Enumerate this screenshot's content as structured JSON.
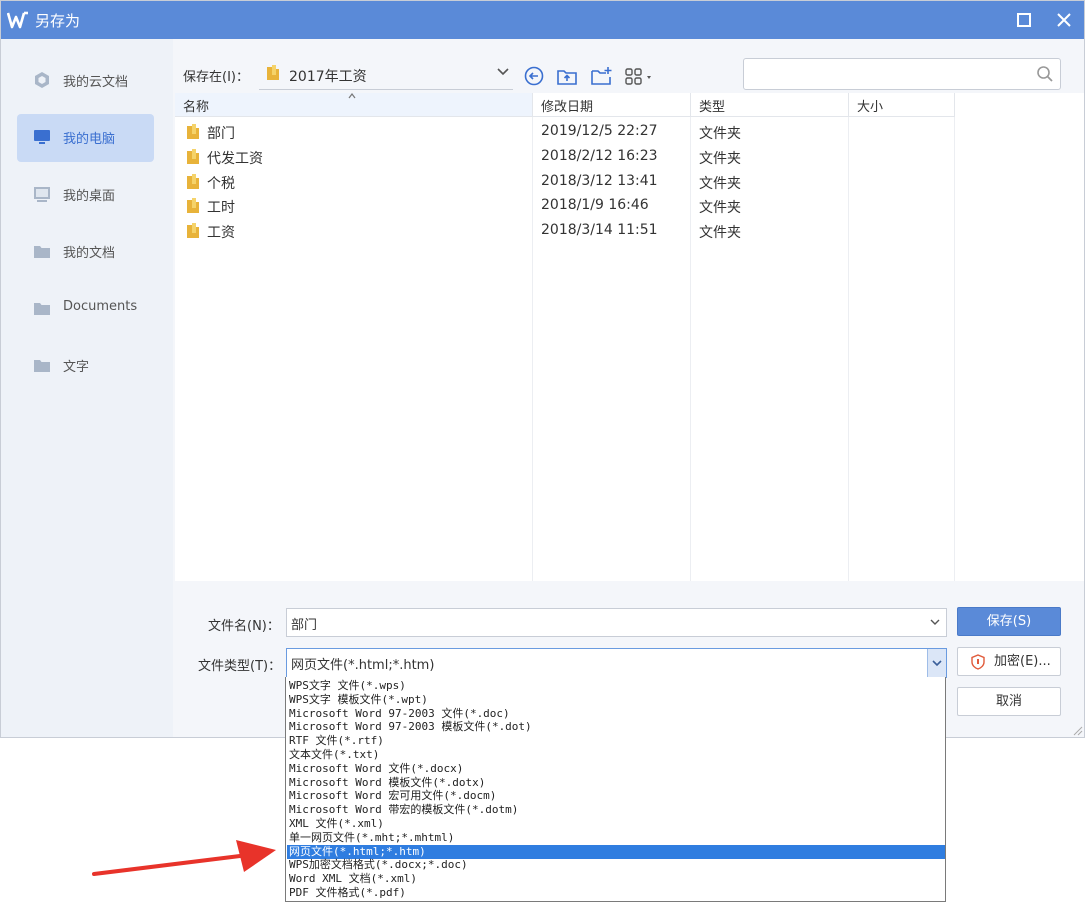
{
  "window": {
    "title": "另存为"
  },
  "sidebar": {
    "items": [
      {
        "label": "我的云文档",
        "icon": "cloud-docs-icon"
      },
      {
        "label": "我的电脑",
        "icon": "computer-icon",
        "active": true
      },
      {
        "label": "我的桌面",
        "icon": "desktop-icon"
      },
      {
        "label": "我的文档",
        "icon": "folder-icon"
      },
      {
        "label": "Documents",
        "icon": "folder-icon"
      },
      {
        "label": "文字",
        "icon": "folder-icon"
      }
    ]
  },
  "location": {
    "label": "保存在(I)：",
    "path": "2017年工资"
  },
  "columns": {
    "name": "名称",
    "modified": "修改日期",
    "type": "类型",
    "size": "大小"
  },
  "files": [
    {
      "name": "部门",
      "modified": "2019/12/5 22:27",
      "type": "文件夹"
    },
    {
      "name": "代发工资",
      "modified": "2018/2/12 16:23",
      "type": "文件夹"
    },
    {
      "name": "个税",
      "modified": "2018/3/12 13:41",
      "type": "文件夹"
    },
    {
      "name": "工时",
      "modified": "2018/1/9 16:46",
      "type": "文件夹"
    },
    {
      "name": "工资",
      "modified": "2018/3/14 11:51",
      "type": "文件夹"
    }
  ],
  "form": {
    "filename_label": "文件名(N)：",
    "filename_value": "部门",
    "filetype_label": "文件类型(T)：",
    "filetype_value": "网页文件(*.html;*.htm)"
  },
  "buttons": {
    "save": "保存(S)",
    "encrypt": "加密(E)...",
    "cancel": "取消"
  },
  "filetype_options": [
    "WPS文字 文件(*.wps)",
    "WPS文字 模板文件(*.wpt)",
    "Microsoft Word 97-2003 文件(*.doc)",
    "Microsoft Word 97-2003 模板文件(*.dot)",
    "RTF 文件(*.rtf)",
    "文本文件(*.txt)",
    "Microsoft Word 文件(*.docx)",
    "Microsoft Word 模板文件(*.dotx)",
    "Microsoft Word 宏可用文件(*.docm)",
    "Microsoft Word 带宏的模板文件(*.dotm)",
    "XML 文件(*.xml)",
    "单一网页文件(*.mht;*.mhtml)",
    "网页文件(*.html;*.htm)",
    "WPS加密文档格式(*.docx;*.doc)",
    "Word XML 文档(*.xml)",
    "PDF 文件格式(*.pdf)"
  ],
  "selected_filetype_index": 12,
  "colors": {
    "accent": "#5a8ad8",
    "selection": "#2f7de0",
    "arrow": "#e8332a"
  }
}
